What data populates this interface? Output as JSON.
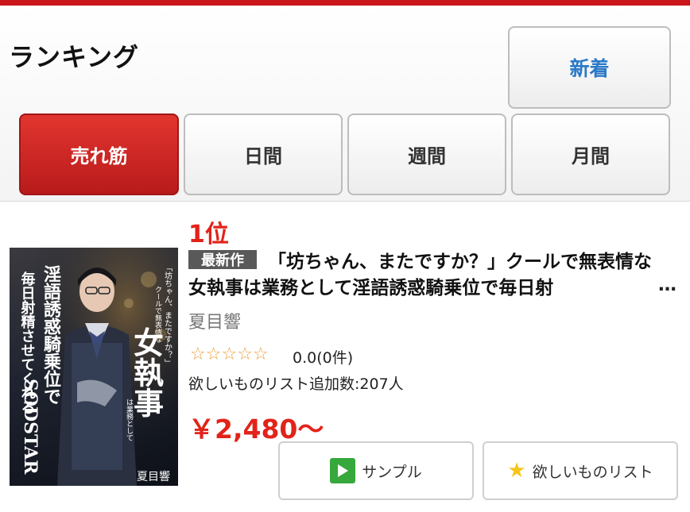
{
  "header": {
    "title": "ランキング",
    "new_label": "新着"
  },
  "tabs": [
    {
      "label": "売れ筋",
      "active": true
    },
    {
      "label": "日間",
      "active": false
    },
    {
      "label": "週間",
      "active": false
    },
    {
      "label": "月間",
      "active": false
    }
  ],
  "item": {
    "rank": "1位",
    "badge": "最新作",
    "title": "「坊ちゃん、またですか？」クールで無表情な女執事は業務として淫語誘惑騎乗位で毎日射",
    "ellipsis": "…",
    "actress": "夏目響",
    "rating": "0.0(0件)",
    "wishlist_count": "欲しいものリスト追加数:207人",
    "price": "￥2,480〜",
    "cover": {
      "side_text_1": "毎日射精させてくれる",
      "side_text_2": "淫語誘惑騎乗位で",
      "tagline": "「坊ちゃん、またですか？」",
      "sub": "クールで無表情な",
      "main": "女執事",
      "small": "は業務として",
      "brand": "SODSTAR",
      "name": "夏目響"
    }
  },
  "actions": {
    "sample_label": "サンプル",
    "wishlist_label": "欲しいものリスト"
  },
  "colors": {
    "accent_red": "#e2231a",
    "tab_active": "#c9161b",
    "link_blue": "#2a79c7",
    "play_green": "#37a83b",
    "star_gold": "#f5c518"
  }
}
